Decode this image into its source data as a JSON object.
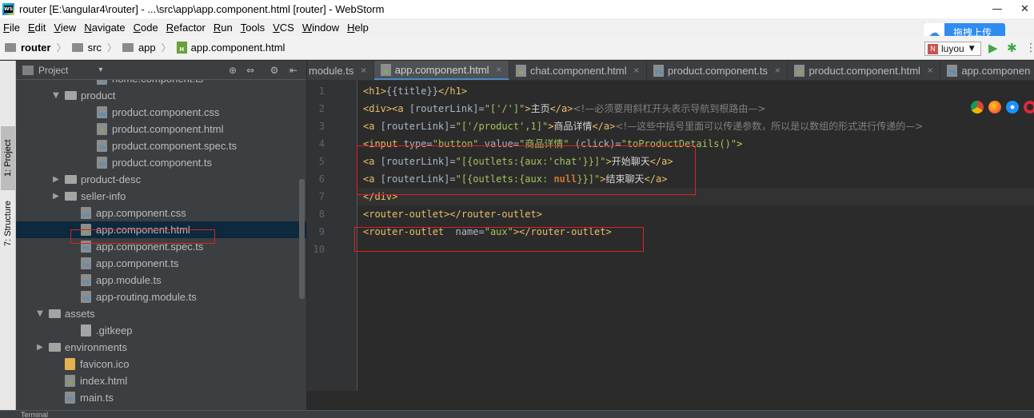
{
  "window": {
    "title": "router [E:\\angular4\\router] - ...\\src\\app\\app.component.html [router] - WebStorm",
    "app_icon_text": "WS",
    "minimize_icon": "—",
    "close_icon": "✕"
  },
  "menu": [
    "File",
    "Edit",
    "View",
    "Navigate",
    "Code",
    "Refactor",
    "Run",
    "Tools",
    "VCS",
    "Window",
    "Help"
  ],
  "upload_widget": {
    "label": "拖拽上传",
    "icon": "cloud-icon"
  },
  "breadcrumbs": [
    "router",
    "src",
    "app",
    "app.component.html"
  ],
  "run_config": {
    "user": "luyou",
    "icon_letter": "N"
  },
  "toolstrip": {
    "project_tab": "1: Project",
    "structure_tab": "7: Structure"
  },
  "project_panel": {
    "title": "Project",
    "caret": "▾",
    "tools": [
      "⊕",
      "⇔",
      "⚙",
      "⇤"
    ],
    "tree": [
      {
        "label": "home.component.ts",
        "indent": 5,
        "type": "ts",
        "arrow": ""
      },
      {
        "label": "product",
        "indent": 3,
        "type": "folder",
        "arrow": "▼"
      },
      {
        "label": "product.component.css",
        "indent": 5,
        "type": "css",
        "arrow": ""
      },
      {
        "label": "product.component.html",
        "indent": 5,
        "type": "html",
        "arrow": ""
      },
      {
        "label": "product.component.spec.ts",
        "indent": 5,
        "type": "ts",
        "arrow": ""
      },
      {
        "label": "product.component.ts",
        "indent": 5,
        "type": "ts",
        "arrow": ""
      },
      {
        "label": "product-desc",
        "indent": 3,
        "type": "folder",
        "arrow": "▶"
      },
      {
        "label": "seller-info",
        "indent": 3,
        "type": "folder",
        "arrow": "▶"
      },
      {
        "label": "app.component.css",
        "indent": 4,
        "type": "css",
        "arrow": ""
      },
      {
        "label": "app.component.html",
        "indent": 4,
        "type": "html",
        "arrow": "",
        "selected": true
      },
      {
        "label": "app.component.spec.ts",
        "indent": 4,
        "type": "ts",
        "arrow": ""
      },
      {
        "label": "app.component.ts",
        "indent": 4,
        "type": "ts",
        "arrow": ""
      },
      {
        "label": "app.module.ts",
        "indent": 4,
        "type": "ts",
        "arrow": ""
      },
      {
        "label": "app-routing.module.ts",
        "indent": 4,
        "type": "ts",
        "arrow": ""
      },
      {
        "label": "assets",
        "indent": 2,
        "type": "folder",
        "arrow": "▼"
      },
      {
        "label": ".gitkeep",
        "indent": 4,
        "type": "plain",
        "arrow": ""
      },
      {
        "label": "environments",
        "indent": 2,
        "type": "folder",
        "arrow": "▶"
      },
      {
        "label": "favicon.ico",
        "indent": 3,
        "type": "ico",
        "arrow": ""
      },
      {
        "label": "index.html",
        "indent": 3,
        "type": "html",
        "arrow": ""
      },
      {
        "label": "main.ts",
        "indent": 3,
        "type": "ts",
        "arrow": ""
      }
    ]
  },
  "tabs": [
    {
      "label": "module.ts",
      "type": "ts",
      "active": false
    },
    {
      "label": "app.component.html",
      "type": "html",
      "active": true
    },
    {
      "label": "chat.component.html",
      "type": "html",
      "active": false
    },
    {
      "label": "product.component.ts",
      "type": "ts",
      "active": false
    },
    {
      "label": "product.component.html",
      "type": "html",
      "active": false
    },
    {
      "label": "app.componen",
      "type": "ts",
      "active": false
    }
  ],
  "tab_close_icon": "×",
  "editor": {
    "line_numbers": [
      "1",
      "2",
      "3",
      "4",
      "5",
      "6",
      "7",
      "8",
      "9",
      "10"
    ],
    "lines": [
      "<h1>{{title}}</h1>",
      "<div><a [routerLink]=\"['/']\">主页</a><!—必须要用斜杠开头表示导航到根路由—>",
      "<a [routerLink]=\"['/product',1]\">商品详情</a><!—这些中括号里面可以传递参数，所以是以数组的形式进行传递的—>",
      "<input type=\"button\" value=\"商品详情\" (click)=\"toProductDetails()\">",
      "<a [routerLink]=\"[{outlets:{aux:'chat'}}]\">开始聊天</a>",
      "<a [routerLink]=\"[{outlets:{aux: null}}]\">结束聊天</a>",
      "</div>",
      "<router-outlet></router-outlet>",
      "<router-outlet  name=\"aux\"></router-outlet>",
      ""
    ]
  },
  "status": {
    "terminal_label": "Terminal"
  },
  "colors": {
    "editor_bg": "#2b2b2b",
    "tag": "#e8bf6a",
    "string": "#a5c25c",
    "comment": "#808080",
    "keyword": "#cc7832",
    "annotation_red": "#e02020",
    "selection": "#0d293e",
    "accent_blue": "#4a88c7"
  }
}
